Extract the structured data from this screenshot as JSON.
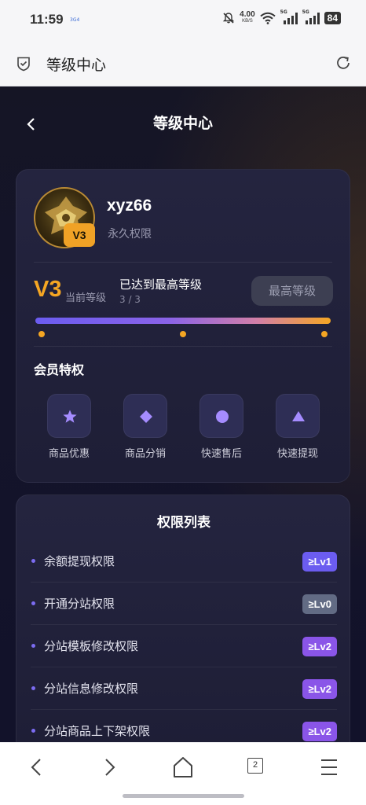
{
  "status_bar": {
    "time": "11:59",
    "tiny_indicator": "3G4",
    "net_speed": "4.00",
    "net_unit": "KB/S",
    "sim1_tag": "5G",
    "sim2_tag": "5G",
    "battery": "84"
  },
  "browser": {
    "title": "等级中心"
  },
  "app": {
    "title": "等级中心",
    "profile": {
      "username": "xyz66",
      "permission": "永久权限",
      "badge": "V3",
      "level": "V3",
      "level_label": "当前等级",
      "status": "已达到最高等级",
      "progress_text": "3 / 3",
      "progress": 1.0,
      "max_button": "最高等级"
    },
    "privileges": {
      "title": "会员特权",
      "items": [
        {
          "label": "商品优惠",
          "icon": "star-icon"
        },
        {
          "label": "商品分销",
          "icon": "diamond-icon"
        },
        {
          "label": "快速售后",
          "icon": "circle-icon"
        },
        {
          "label": "快速提现",
          "icon": "triangle-icon"
        }
      ]
    },
    "permissions": {
      "title": "权限列表",
      "rows": [
        {
          "name": "余额提现权限",
          "level": "≥Lv1",
          "color": "#6b5cf0"
        },
        {
          "name": "开通分站权限",
          "level": "≥Lv0",
          "color": "#626b84"
        },
        {
          "name": "分站模板修改权限",
          "level": "≥Lv2",
          "color": "#8a55e8"
        },
        {
          "name": "分站信息修改权限",
          "level": "≥Lv2",
          "color": "#8a55e8"
        },
        {
          "name": "分站商品上下架权限",
          "level": "≥Lv2",
          "color": "#8a55e8"
        }
      ]
    }
  },
  "colors": {
    "accent_gold": "#f5a623",
    "accent_purple": "#6b5cf0",
    "background": "#151525"
  },
  "bottom_nav": {
    "tab_count": "2"
  }
}
